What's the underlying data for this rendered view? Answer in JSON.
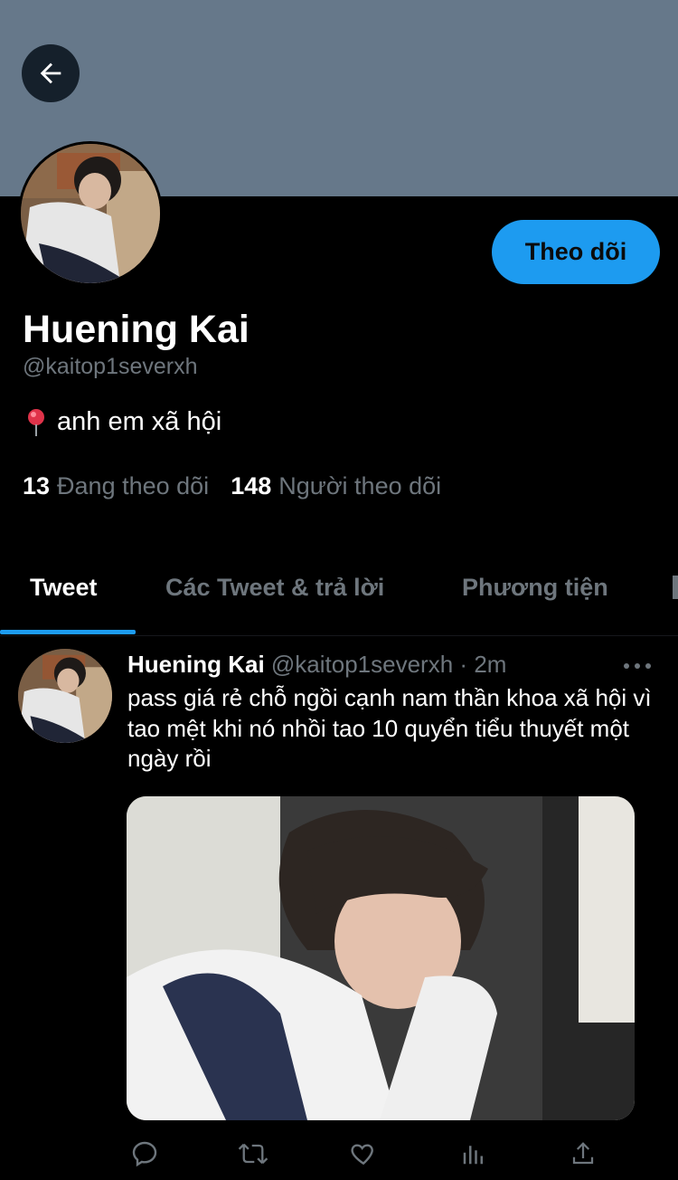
{
  "profile": {
    "name": "Huening Kai",
    "handle": "@kaitop1severxh",
    "bio": "anh em xã hội",
    "follow_label": "Theo dõi",
    "following_count": "13",
    "following_label": "Đang theo dõi",
    "followers_count": "148",
    "followers_label": "Người theo dõi"
  },
  "tabs": [
    {
      "label": "Tweet"
    },
    {
      "label": "Các Tweet & trả lời"
    },
    {
      "label": "Phương tiện"
    }
  ],
  "tweet": {
    "name": "Huening Kai",
    "handle": "@kaitop1severxh",
    "separator": "·",
    "time": "2m",
    "text": "pass giá rẻ chỗ ngồi cạnh nam thần khoa xã hội vì tao mệt khi nó nhồi tao 10 quyển tiểu thuyết một ngày rồi"
  },
  "colors": {
    "banner": "#66788a",
    "accent": "#1d9bf0",
    "muted": "#6e767d",
    "background": "#000000"
  },
  "icons": [
    "back-arrow-icon",
    "location-pin-icon",
    "more-icon",
    "reply-icon",
    "retweet-icon",
    "like-icon",
    "analytics-icon",
    "share-icon"
  ]
}
